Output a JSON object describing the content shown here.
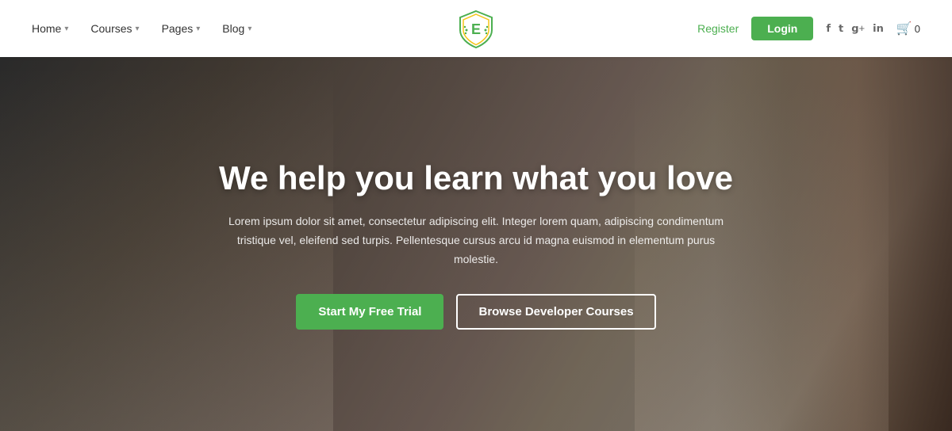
{
  "navbar": {
    "nav_items": [
      {
        "label": "Home",
        "has_dropdown": true
      },
      {
        "label": "Courses",
        "has_dropdown": true
      },
      {
        "label": "Pages",
        "has_dropdown": true
      },
      {
        "label": "Blog",
        "has_dropdown": true
      }
    ],
    "register_label": "Register",
    "login_label": "Login",
    "social_icons": [
      "f",
      "t",
      "g+",
      "in"
    ],
    "cart_count": "0"
  },
  "hero": {
    "title": "We help you learn what you love",
    "subtitle": "Lorem ipsum dolor sit amet, consectetur adipiscing elit. Integer lorem quam, adipiscing condimentum tristique vel, eleifend sed turpis.\nPellentesque cursus arcu id magna euismod in elementum purus molestie.",
    "btn_primary": "Start My Free Trial",
    "btn_outline": "Browse Developer Courses"
  },
  "logo": {
    "alt": "EduSite Logo"
  }
}
